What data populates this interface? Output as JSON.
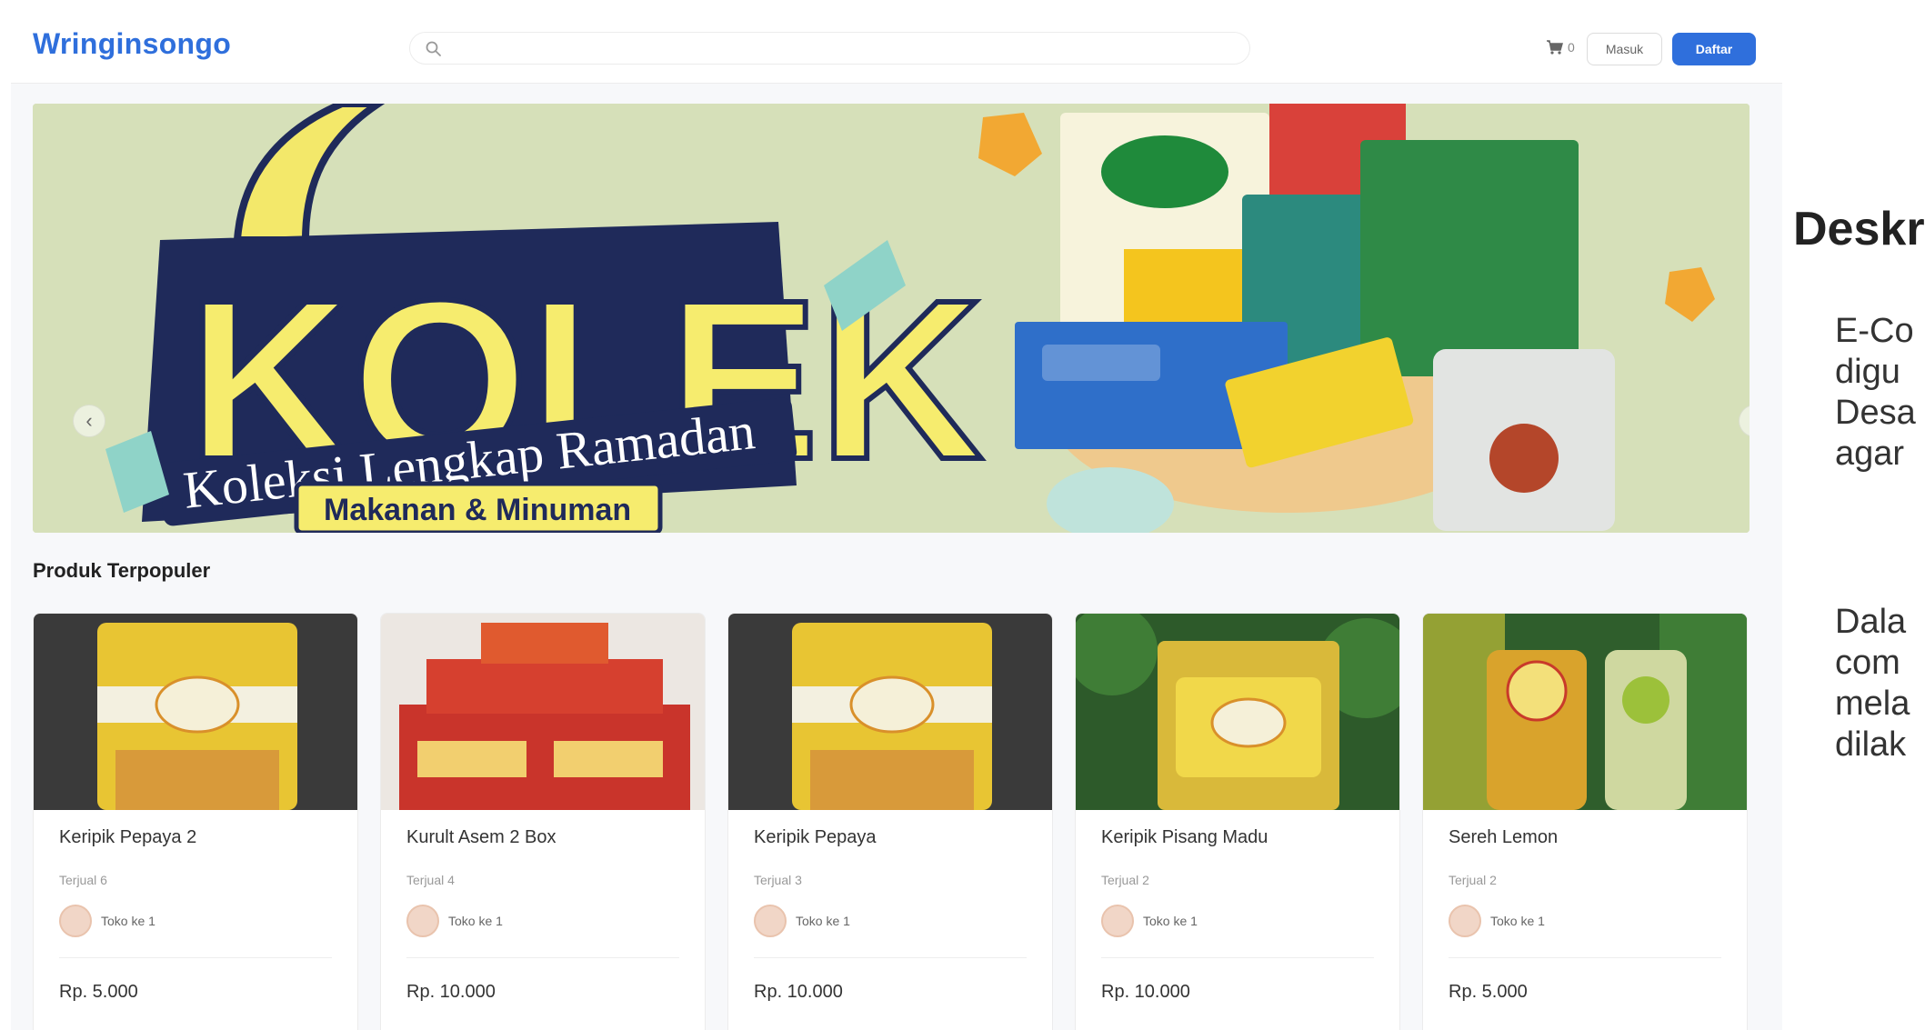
{
  "header": {
    "brand": "Wringinsongo",
    "search_placeholder": "",
    "cart_count": "0",
    "login_label": "Masuk",
    "register_label": "Daftar"
  },
  "banner": {
    "title": "KOLEK",
    "subtitle": "Koleksi Lengkap Ramadan",
    "tagline": "Makanan & Minuman",
    "slide_count": 2,
    "active_slide": 2
  },
  "section": {
    "title": "Produk Terpopuler"
  },
  "products": [
    {
      "name": "Keripik Pepaya 2",
      "sold": "Terjual 6",
      "store": "Toko ke 1",
      "price": "Rp. 5.000"
    },
    {
      "name": "Kurult Asem 2 Box",
      "sold": "Terjual 4",
      "store": "Toko ke 1",
      "price": "Rp. 10.000"
    },
    {
      "name": "Keripik Pepaya",
      "sold": "Terjual 3",
      "store": "Toko ke 1",
      "price": "Rp. 10.000"
    },
    {
      "name": "Keripik Pisang Madu",
      "sold": "Terjual 2",
      "store": "Toko ke 1",
      "price": "Rp. 10.000"
    },
    {
      "name": "Sereh Lemon",
      "sold": "Terjual 2",
      "store": "Toko ke 1",
      "price": "Rp. 5.000"
    }
  ],
  "description": {
    "title": "Deskripsi",
    "p1": [
      "E-Co",
      "digu",
      "Desa",
      "agar"
    ],
    "p2": [
      "Dala",
      "com",
      "mela",
      "dilak"
    ]
  }
}
